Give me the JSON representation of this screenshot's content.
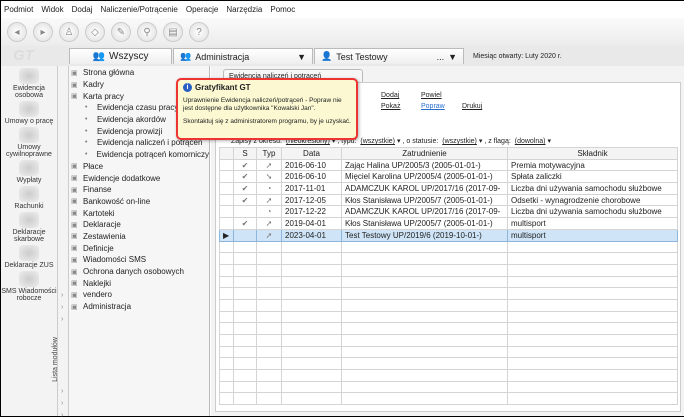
{
  "menu": [
    "Podmiot",
    "Widok",
    "Dodaj",
    "Naliczenie/Potrącenie",
    "Operacje",
    "Narzędzia",
    "Pomoc"
  ],
  "tabs": {
    "all": "Wszyscy",
    "group": "Administracja",
    "employee": "Test Testowy",
    "employee_more": "...",
    "month": "Miesiąc otwarty: Luty 2020 r."
  },
  "logo": "GT",
  "left_icons": [
    "Ewidencja osobowa",
    "Umowy o pracę",
    "Umowy cywilnoprawne",
    "Wypłaty",
    "Rachunki",
    "Deklaracje skarbowe",
    "Deklaracje ZUS",
    "SMS Wiadomości robocze"
  ],
  "module_strip": "Lista modułów",
  "tree": [
    {
      "label": "Strona główna",
      "sub": false
    },
    {
      "label": "Kadry",
      "sub": false
    },
    {
      "label": "Karta pracy",
      "sub": false
    },
    {
      "label": "Ewidencja czasu pracy",
      "sub": true
    },
    {
      "label": "Ewidencja akordów",
      "sub": true
    },
    {
      "label": "Ewidencja prowizji",
      "sub": true
    },
    {
      "label": "Ewidencja naliczeń i potrąceń",
      "sub": true
    },
    {
      "label": "Ewidencja potrąceń komorniczy",
      "sub": true
    },
    {
      "label": "Płace",
      "sub": false
    },
    {
      "label": "Ewidencje dodatkowe",
      "sub": false
    },
    {
      "label": "Finanse",
      "sub": false
    },
    {
      "label": "Bankowość on-line",
      "sub": false
    },
    {
      "label": "Kartoteki",
      "sub": false
    },
    {
      "label": "Deklaracje",
      "sub": false
    },
    {
      "label": "Zestawienia",
      "sub": false
    },
    {
      "label": "Definicje",
      "sub": false
    },
    {
      "label": "Wiadomości SMS",
      "sub": false
    },
    {
      "label": "Ochrona danych osobowych",
      "sub": false
    },
    {
      "label": "Naklejki",
      "sub": false
    },
    {
      "label": "vendero",
      "sub": false
    },
    {
      "label": "Administracja",
      "sub": false
    }
  ],
  "doc_tab": "Ewidencja naliczeń i potrąceń",
  "actions": {
    "add": "Dodaj",
    "copy": "Powiel",
    "show": "Pokaż",
    "edit": "Popraw",
    "print": "Drukuj"
  },
  "filters": {
    "period_label": "Zapisy z okresu:",
    "period": "(nieokreślony)",
    "type_label": ", typu:",
    "type": "(wszystkie)",
    "status_label": ", o statusie:",
    "status": "(wszystkie)",
    "flag_label": ", z flagą:",
    "flag": "(dowolna)"
  },
  "columns": [
    "S",
    "Typ",
    "Data",
    "Zatrudnienie",
    "Składnik"
  ],
  "rows": [
    {
      "s": "✔",
      "typ": "➚",
      "data": "2016-06-10",
      "emp": "Zając Halina UP/2005/3 (2005-01-01-)",
      "comp": "Premia motywacyjna"
    },
    {
      "s": "✔",
      "typ": "➘",
      "data": "2016-06-10",
      "emp": "Mięciel Karolina UP/2005/4 (2005-01-01-)",
      "comp": "Spłata zaliczki"
    },
    {
      "s": "✔",
      "typ": "◔",
      "data": "2017-11-01",
      "emp": "ADAMCZUK KAROL UP/2017/16 (2017-09-",
      "comp": "Liczba dni używania samochodu służbowe"
    },
    {
      "s": "✔",
      "typ": "➚",
      "data": "2017-12-05",
      "emp": "Kłos Stanisława UP/2005/7 (2005-01-01-)",
      "comp": "Odsetki - wynagrodzenie chorobowe"
    },
    {
      "s": "",
      "typ": "◔",
      "data": "2017-12-22",
      "emp": "ADAMCZUK KAROL UP/2017/16 (2017-09-",
      "comp": "Liczba dni używania samochodu służbowe"
    },
    {
      "s": "✔",
      "typ": "➚",
      "data": "2019-04-01",
      "emp": "Kłos Stanisława UP/2005/7 (2005-01-01-)",
      "comp": "multisport"
    },
    {
      "s": "",
      "typ": "➚",
      "data": "2023-04-01",
      "emp": "Test Testowy UP/2019/6 (2019-10-01-)",
      "comp": "multisport",
      "selected": true
    }
  ],
  "tooltip": {
    "title": "Gratyfikant GT",
    "line1": "Uprawnienie Ewidencja naliczeń/potrąceń - Popraw nie jest dostępne dla użytkownika \"Kowalski Jan\".",
    "line2": "Skontaktuj się z administratorem programu, by je uzyskać."
  },
  "colors": {
    "tooltip_border": "#e33333",
    "selected_row": "#cfe4f6",
    "link_active": "#2a6fd0"
  }
}
